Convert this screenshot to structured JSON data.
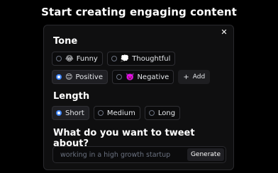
{
  "headline": "Start creating engaging content",
  "tone": {
    "title": "Tone",
    "options": [
      {
        "emoji": "😂",
        "label": "Funny",
        "selected": false
      },
      {
        "emoji": "💭",
        "label": "Thoughtful",
        "selected": false
      },
      {
        "emoji": "😊",
        "label": "Positive",
        "selected": true
      },
      {
        "emoji": "👿",
        "label": "Negative",
        "selected": false
      }
    ],
    "add_label": "Add"
  },
  "length": {
    "title": "Length",
    "options": [
      {
        "label": "Short",
        "selected": true
      },
      {
        "label": "Medium",
        "selected": false
      },
      {
        "label": "Long",
        "selected": false
      }
    ]
  },
  "tweet": {
    "title": "What do you want to tweet about?",
    "placeholder": "working in a high growth startup",
    "button_label": "Generate"
  },
  "colors": {
    "accent": "#3b82f6",
    "background": "#000000",
    "card": "#0f0f10"
  }
}
